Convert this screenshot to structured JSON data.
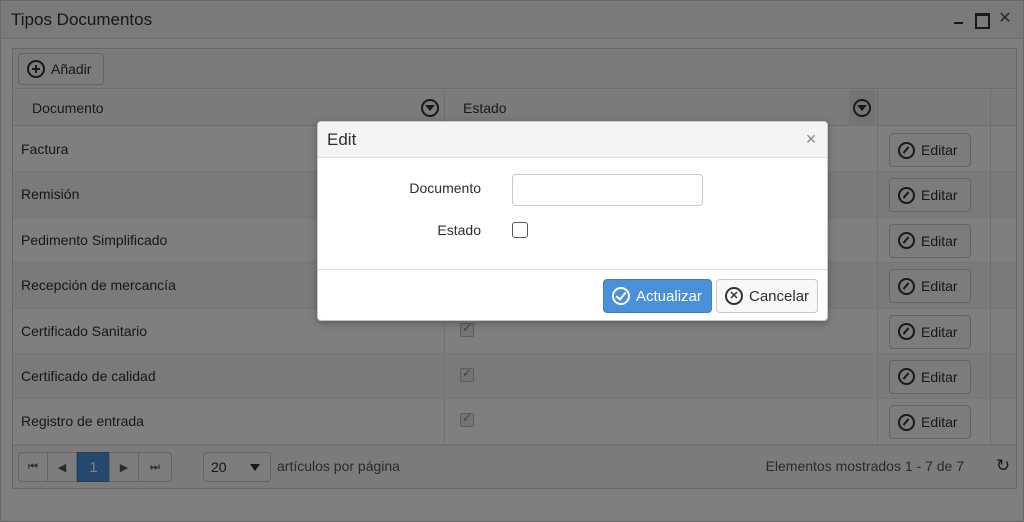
{
  "window": {
    "title": "Tipos Documentos",
    "close_glyph": "✕"
  },
  "toolbar": {
    "add_label": "Añadir"
  },
  "columns": {
    "documento": "Documento",
    "estado": "Estado"
  },
  "rows": [
    {
      "documento": "Factura",
      "estado": true
    },
    {
      "documento": "Remisión",
      "estado": true
    },
    {
      "documento": "Pedimento Simplificado",
      "estado": true
    },
    {
      "documento": "Recepción de mercancía",
      "estado": true
    },
    {
      "documento": "Certificado Sanitario",
      "estado": true
    },
    {
      "documento": "Certificado de calidad",
      "estado": true
    },
    {
      "documento": "Registro de entrada",
      "estado": true
    }
  ],
  "row_action_label": "Editar",
  "pager": {
    "first_glyph": "⏮",
    "prev_glyph": "◀",
    "next_glyph": "▶",
    "last_glyph": "⏭",
    "current_page": "1",
    "page_size": "20",
    "items_per_page_label": "artículos por página",
    "info": "Elementos mostrados 1 - 7 de 7",
    "refresh_glyph": "↻"
  },
  "modal": {
    "title": "Edit",
    "close_glyph": "×",
    "documento_label": "Documento",
    "documento_value": "",
    "estado_label": "Estado",
    "estado_checked": false,
    "update_label": "Actualizar",
    "cancel_label": "Cancelar"
  },
  "colors": {
    "primary": "#4a90d9",
    "overlay": "rgba(0,0,0,0.5)"
  },
  "icons": [
    "plus-circle-icon",
    "filter-icon",
    "edit-icon",
    "check-circle-icon",
    "cancel-icon",
    "refresh-icon",
    "minimize-icon",
    "maximize-icon",
    "close-icon"
  ]
}
